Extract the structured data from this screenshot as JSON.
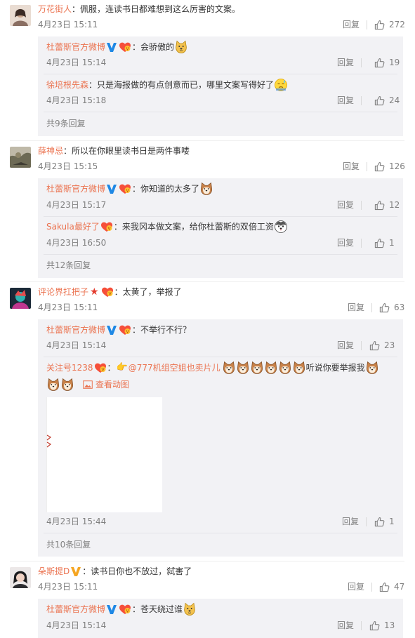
{
  "colors": {
    "accent": "#eb7350",
    "meta": "#808080",
    "panel_bg": "#f2f2f5",
    "verified_blue": "#1e88e5",
    "verified_gold": "#f5a623"
  },
  "reply_label": "回复",
  "comments": [
    {
      "user": "万花街人",
      "text": "：佩服，连读书日都难想到这么厉害的文案。",
      "date": "4月23日 15:11",
      "likes": "272",
      "replies": [
        {
          "user": "杜蕾斯官方微博",
          "text": "：会骄傲的",
          "date": "4月23日 15:14",
          "likes": "19"
        },
        {
          "user": "徐培根先森",
          "text": "：只是海报做的有点创意而已，哪里文案写得好了",
          "date": "4月23日 15:18",
          "likes": "24"
        }
      ],
      "more": "共9条回复"
    },
    {
      "user": "薛神忌",
      "text": "：所以在你眼里读书日是两件事喽",
      "date": "4月23日 15:15",
      "likes": "126",
      "replies": [
        {
          "user": "杜蕾斯官方微博",
          "text": "：你知道的太多了",
          "date": "4月23日 15:17",
          "likes": "12"
        },
        {
          "user": "Sakula最好了",
          "text": "：来我冈本做文案，给你杜蕾斯的双倍工资",
          "date": "4月23日 16:50",
          "likes": "1"
        }
      ],
      "more": "共12条回复"
    },
    {
      "user": "评论界扛把子",
      "text": "：太黄了，举报了",
      "date": "4月23日 15:11",
      "likes": "63",
      "replies": [
        {
          "user": "杜蕾斯官方微博",
          "text": "：不举行不行？",
          "date": "4月23日 15:14",
          "likes": "23"
        },
        {
          "user": "关注号1238",
          "text_a": "：",
          "mention": "@777机组空姐也卖片儿",
          "text_b": "听说你要举报我",
          "gif_label": "查看动图",
          "date": "4月23日 15:44",
          "likes": "1"
        }
      ],
      "more": "共10条回复"
    },
    {
      "user": "朵斯提D",
      "text": "：读书日你也不放过，弑害了",
      "date": "4月23日 15:11",
      "likes": "47",
      "replies": [
        {
          "user": "杜蕾斯官方微博",
          "text": "：苍天绕过谁",
          "date": "4月23日 15:14",
          "likes": "13"
        }
      ]
    }
  ]
}
